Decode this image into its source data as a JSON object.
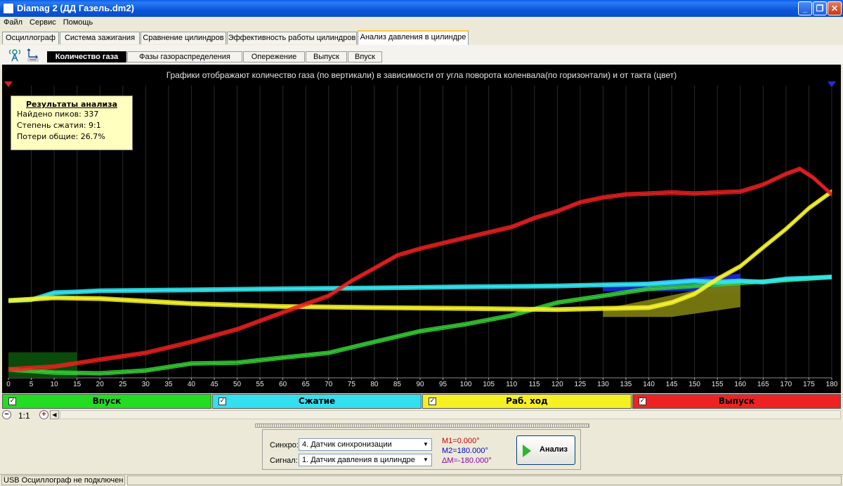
{
  "window": {
    "title": "Diamag 2 (ДД  Газель.dm2)",
    "min_glyph": "_",
    "max_glyph": "❐",
    "close_glyph": "✕",
    "icon": "app-logo-icon"
  },
  "menu": [
    "Файл",
    "Сервис",
    "Помощь"
  ],
  "tabs": [
    {
      "label": "Осциллограф"
    },
    {
      "label": "Система зажигания"
    },
    {
      "label": "Сравнение цилиндров"
    },
    {
      "label": "Эффективность работы цилиндров"
    },
    {
      "label": "Анализ давления в цилиндре",
      "active": true
    }
  ],
  "toolbar_icons": [
    "antenna-icon",
    "scale-icon"
  ],
  "subtabs": [
    {
      "label": "Количество газа",
      "active": true
    },
    {
      "label": "Фазы газораспределения"
    },
    {
      "label": "Опережение"
    },
    {
      "label": "Выпуск"
    },
    {
      "label": "Впуск"
    }
  ],
  "chart_data": {
    "type": "line",
    "title": "Графики отображают количество газа (по вертикали) в зависимости от угла поворота коленвала(по горизонтали) и от такта (цвет)",
    "xlabel": "",
    "ylabel": "",
    "xlim": [
      0,
      180
    ],
    "x_ticks": [
      0,
      5,
      10,
      15,
      20,
      25,
      30,
      35,
      40,
      45,
      50,
      55,
      60,
      65,
      70,
      75,
      80,
      85,
      90,
      95,
      100,
      105,
      110,
      115,
      120,
      125,
      130,
      135,
      140,
      145,
      150,
      155,
      160,
      165,
      170,
      175,
      180
    ],
    "grid": true,
    "series": [
      {
        "name": "Впуск",
        "color": "#ee2020",
        "x": [
          0,
          10,
          20,
          30,
          40,
          50,
          60,
          70,
          75,
          80,
          85,
          90,
          100,
          110,
          115,
          120,
          125,
          130,
          135,
          140,
          145,
          150,
          155,
          160,
          165,
          170,
          173,
          176,
          180
        ],
        "y": [
          0.04,
          0.06,
          0.09,
          0.13,
          0.18,
          0.25,
          0.33,
          0.42,
          0.49,
          0.56,
          0.62,
          0.66,
          0.71,
          0.77,
          0.81,
          0.85,
          0.89,
          0.92,
          0.93,
          0.94,
          0.94,
          0.94,
          0.94,
          0.95,
          0.98,
          1.04,
          1.06,
          1.02,
          0.93
        ]
      },
      {
        "name": "Сжатие",
        "color": "#33e6ef",
        "x": [
          0,
          5,
          10,
          15,
          20,
          40,
          60,
          80,
          100,
          120,
          130,
          140,
          150,
          155,
          160,
          165,
          170,
          175,
          180
        ],
        "y": [
          0.39,
          0.4,
          0.43,
          0.44,
          0.44,
          0.45,
          0.45,
          0.46,
          0.46,
          0.47,
          0.47,
          0.48,
          0.49,
          0.49,
          0.49,
          0.49,
          0.5,
          0.51,
          0.51
        ]
      },
      {
        "name": "Раб. ход",
        "color": "#f5f22a",
        "x": [
          0,
          10,
          20,
          40,
          60,
          80,
          100,
          120,
          130,
          140,
          145,
          150,
          155,
          160,
          165,
          170,
          175,
          180
        ],
        "y": [
          0.39,
          0.41,
          0.4,
          0.38,
          0.36,
          0.36,
          0.35,
          0.35,
          0.35,
          0.36,
          0.38,
          0.43,
          0.5,
          0.57,
          0.66,
          0.76,
          0.86,
          0.95
        ]
      },
      {
        "name": "Выпуск",
        "color": "#35d335",
        "x": [
          0,
          10,
          20,
          30,
          40,
          50,
          60,
          70,
          80,
          90,
          100,
          110,
          120,
          130,
          140,
          150,
          160,
          170,
          180
        ],
        "y": [
          0.04,
          0.03,
          0.02,
          0.04,
          0.07,
          0.08,
          0.1,
          0.13,
          0.18,
          0.24,
          0.27,
          0.32,
          0.38,
          0.42,
          0.45,
          0.47,
          0.48,
          0.5,
          0.51
        ]
      }
    ],
    "overlays": [
      {
        "name": "green-block",
        "color": "#0a4a0a",
        "x0": 0,
        "x1": 15,
        "y0": 0.0,
        "y1": 0.13
      },
      {
        "name": "blue-block",
        "color": "#1a2ad0",
        "x0": 130,
        "x1": 160,
        "y0": 0.44,
        "y1": 0.53
      },
      {
        "name": "olive-block",
        "color": "#7a7a10",
        "x0": 130,
        "x1": 160,
        "y0": 0.31,
        "y1": 0.49
      }
    ]
  },
  "results": {
    "title": "Результаты анализа",
    "lines": [
      "Найдено пиков: 337",
      "Степень сжатия: 9:1",
      "Потери общие: 26.7%"
    ]
  },
  "phases": [
    {
      "label": "Впуск",
      "color": "#22dd22",
      "check": "✓"
    },
    {
      "label": "Сжатие",
      "color": "#33e0ef",
      "check": "✓"
    },
    {
      "label": "Раб. ход",
      "color": "#f5f022",
      "check": "✓"
    },
    {
      "label": "Выпуск",
      "color": "#ee2222",
      "check": "✓"
    }
  ],
  "zoom": {
    "minus": "−",
    "value": "1:1",
    "plus": "+",
    "scroll_left": "◀"
  },
  "controls": {
    "sync_label": "Синхро:",
    "sync_value": "4.  Датчик синхронизации",
    "signal_label": "Сигнал:",
    "signal_value": "1.  Датчик давления в цилиндре",
    "m1": "M1=0.000°",
    "m2": "M2=180.000°",
    "dm": "ΔM=-180.000°",
    "m1_color": "#cc0000",
    "m2_color": "#0000cc",
    "dm_color": "#8800aa",
    "analyze_label": "Анализ",
    "combo_arrow": "▼"
  },
  "status": {
    "text": "USB Осциллограф не подключен"
  }
}
